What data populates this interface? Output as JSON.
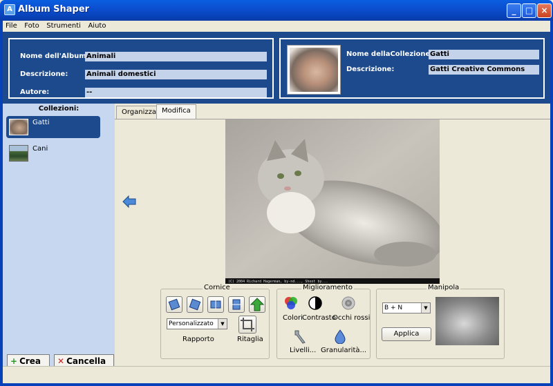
{
  "window": {
    "title": "Album Shaper"
  },
  "menu": [
    "File",
    "Foto",
    "Strumenti",
    "Aiuto"
  ],
  "album": {
    "name_label": "Nome dell'Album:",
    "name_value": "Animali",
    "desc_label": "Descrizione:",
    "desc_value": "Animali domestici",
    "author_label": "Autore:",
    "author_value": "--"
  },
  "collection": {
    "name_label": "Nome dellaCollezione:",
    "name_value": "Gatti",
    "desc_label": "Descrizione:",
    "desc_value": "Gatti Creative Commons"
  },
  "sidebar": {
    "heading": "Collezioni:",
    "items": [
      {
        "label": "Gatti",
        "selected": true
      },
      {
        "label": "Cani",
        "selected": false
      }
    ],
    "create_label": "Crea",
    "delete_label": "Cancella"
  },
  "tabs": [
    {
      "label": "Organizza",
      "active": false
    },
    {
      "label": "Modifica",
      "active": true
    }
  ],
  "photo": {
    "caption": "(C) 2004 Richard Hagerman, by-nd..., Shoot by..."
  },
  "frame_group": {
    "title": "Cornice",
    "ratio_value": "Personalizzato",
    "ratio_label": "Rapporto",
    "crop_label": "Ritaglia"
  },
  "enhance_group": {
    "title": "Miglioramento",
    "colors_label": "Colori",
    "contrast_label": "Contrasto",
    "redeye_label": "Occhi rossi",
    "levels_label": "Livelli...",
    "grain_label": "Granularità..."
  },
  "manipulate_group": {
    "title": "Manipola",
    "effect_value": "B + N",
    "apply_label": "Applica"
  },
  "colors": {
    "header_bg": "#1c4a8c",
    "sidebar_bg": "#c6d7ef",
    "field_bg": "#c4d2ea"
  }
}
